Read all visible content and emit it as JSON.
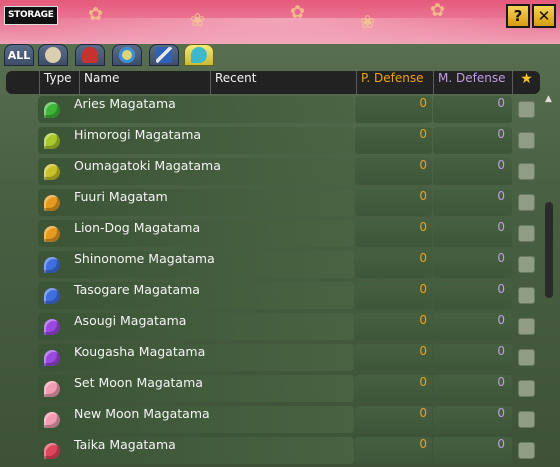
{
  "window": {
    "title": "STORAGE",
    "help_label": "?",
    "close_label": "✕"
  },
  "tabs": [
    {
      "label": "ALL",
      "icon": "all-tab",
      "active": false
    },
    {
      "icon": "pouch-icon",
      "active": false
    },
    {
      "icon": "fan-icon",
      "active": false
    },
    {
      "icon": "crest-icon",
      "active": false
    },
    {
      "icon": "sword-icon",
      "active": false
    },
    {
      "icon": "magatama-icon",
      "active": true
    }
  ],
  "columns": {
    "type": "Type",
    "name": "Name",
    "recent": "Recent",
    "p_defense": "P. Defense",
    "m_defense": "M. Defense",
    "star": "★"
  },
  "items": [
    {
      "name": "Aries Magatama",
      "p_defense": "0",
      "m_defense": "0",
      "color": "#3fb83a"
    },
    {
      "name": "Himorogi Magatama",
      "p_defense": "0",
      "m_defense": "0",
      "color": "#a7c92a"
    },
    {
      "name": "Oumagatoki Magatama",
      "p_defense": "0",
      "m_defense": "0",
      "color": "#c9c12a"
    },
    {
      "name": "Fuuri Magatam",
      "p_defense": "0",
      "m_defense": "0",
      "color": "#e59a1f"
    },
    {
      "name": "Lion-Dog Magatama",
      "p_defense": "0",
      "m_defense": "0",
      "color": "#e59a1f"
    },
    {
      "name": "Shinonome Magatama",
      "p_defense": "0",
      "m_defense": "0",
      "color": "#3f6fe0"
    },
    {
      "name": "Tasogare Magatama",
      "p_defense": "0",
      "m_defense": "0",
      "color": "#3f6fe0"
    },
    {
      "name": "Asougi Magatama",
      "p_defense": "0",
      "m_defense": "0",
      "color": "#9b47e0"
    },
    {
      "name": "Kougasha Magatama",
      "p_defense": "0",
      "m_defense": "0",
      "color": "#9b47e0"
    },
    {
      "name": "Set Moon Magatama",
      "p_defense": "0",
      "m_defense": "0",
      "color": "#f19cb0"
    },
    {
      "name": "New Moon Magatama",
      "p_defense": "0",
      "m_defense": "0",
      "color": "#f19cb0"
    },
    {
      "name": "Taika Magatama",
      "p_defense": "0",
      "m_defense": "0",
      "color": "#e0475e"
    }
  ],
  "colors": {
    "p_defense": "#f0a020",
    "m_defense": "#c39be8",
    "star": "#f6c32d"
  }
}
